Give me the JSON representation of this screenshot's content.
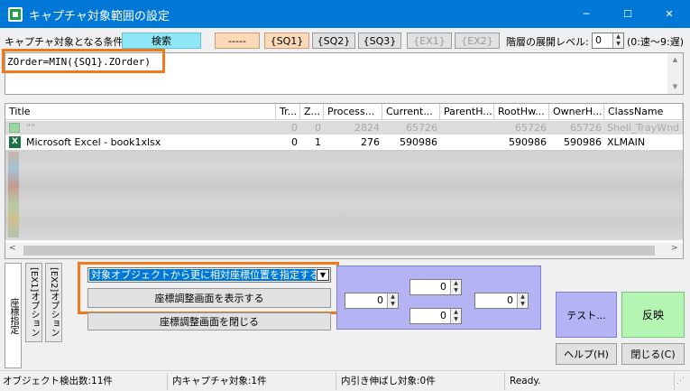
{
  "window": {
    "title": "キャプチャ対象範囲の設定",
    "minimize": "─",
    "maximize": "☐",
    "close": "✕"
  },
  "toolbar": {
    "condition_label": "キャプチャ対象となる条件:",
    "search_label": "検索",
    "dash_label": "-----",
    "sq1_label": "{SQ1}",
    "sq2_label": "{SQ2}",
    "sq3_label": "{SQ3}",
    "ex1_label": "{EX1}",
    "ex2_label": "{EX2}",
    "level_label": "階層の展開レベル:",
    "level_value": "0",
    "level_hint": "(0:速～9:遅)"
  },
  "formula": {
    "text": "ZOrder=MIN({SQ1}.ZOrder)"
  },
  "grid": {
    "columns": [
      "Title",
      "Tr...",
      "Z...",
      "Process...",
      "Current...",
      "ParentH...",
      "RootHw...",
      "OwnerH...",
      "ClassName"
    ],
    "rows": [
      {
        "title": "\"\"",
        "tr": "0",
        "z": "0",
        "process": "2824",
        "current": "65726",
        "parent": "",
        "root": "65726",
        "owner": "65726",
        "classname": "Shell_TrayWnd",
        "faded": true
      },
      {
        "title": "Microsoft Excel - book1xlsx",
        "tr": "0",
        "z": "1",
        "process": "276",
        "current": "590986",
        "parent": "",
        "root": "590986",
        "owner": "590986",
        "classname": "XLMAIN",
        "faded": false
      }
    ]
  },
  "side_tabs": {
    "coord_label": "座標指定",
    "ex1_option_label": "[EX1]オプション",
    "ex2_option_label": "[EX2]オプション"
  },
  "coords": {
    "dropdown_value": "対象オブジェクトから更に相対座標位置を指定する",
    "show_button": "座標調整画面を表示する",
    "close_button": "座標調整画面を閉じる",
    "spin_top": "0",
    "spin_left": "0",
    "spin_right": "0",
    "spin_bottom": "0"
  },
  "actions": {
    "test_label": "テスト...",
    "apply_label": "反映",
    "help_label": "ヘルプ(H)",
    "close_label": "閉じる(C)"
  },
  "status": {
    "detected": "オブジェクト検出数:11件",
    "inner_capture": "内キャプチャ対象:1件",
    "inner_stretch": "内引き伸ばし対象:0件",
    "state": "Ready."
  },
  "colors": {
    "titlebar": "#0078d7",
    "search_button": "#8ee7f7",
    "sq_button": "#fcd9b6",
    "highlight_box": "#f07a1a",
    "coord_panel": "#b4b4f5",
    "test_button": "#b4b4f5",
    "apply_button": "#b4f5b4",
    "selection": "#0078d7"
  }
}
